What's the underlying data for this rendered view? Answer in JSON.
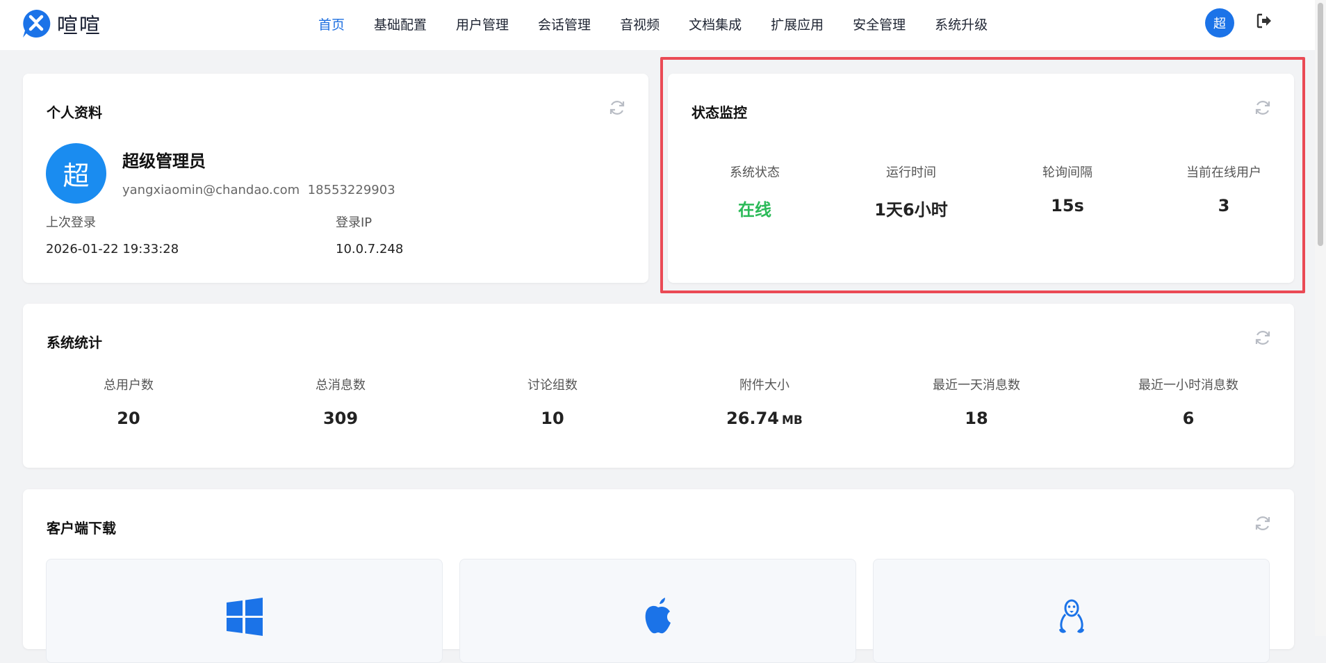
{
  "app": {
    "name": "喧喧"
  },
  "nav": {
    "items": [
      "首页",
      "基础配置",
      "用户管理",
      "会话管理",
      "音视频",
      "文档集成",
      "扩展应用",
      "安全管理",
      "系统升级"
    ],
    "active_index": 0
  },
  "header": {
    "avatar_char": "超"
  },
  "profile": {
    "title": "个人资料",
    "avatar_char": "超",
    "name": "超级管理员",
    "email": "yangxiaomin@chandao.com",
    "phone": "18553229903",
    "last_login_label": "上次登录",
    "last_login_value": "2026-01-22 19:33:28",
    "login_ip_label": "登录IP",
    "login_ip_value": "10.0.7.248"
  },
  "status": {
    "title": "状态监控",
    "metrics": [
      {
        "label": "系统状态",
        "value": "在线"
      },
      {
        "label": "运行时间",
        "value": "1天6小时"
      },
      {
        "label": "轮询间隔",
        "value": "15s"
      },
      {
        "label": "当前在线用户",
        "value": "3"
      }
    ]
  },
  "stats": {
    "title": "系统统计",
    "metrics": [
      {
        "label": "总用户数",
        "value": "20"
      },
      {
        "label": "总消息数",
        "value": "309"
      },
      {
        "label": "讨论组数",
        "value": "10"
      },
      {
        "label": "附件大小",
        "value": "26.74",
        "unit": "MB"
      },
      {
        "label": "最近一天消息数",
        "value": "18"
      },
      {
        "label": "最近一小时消息数",
        "value": "6"
      }
    ]
  },
  "download": {
    "title": "客户端下载",
    "tiles": [
      {
        "icon": "windows-icon"
      },
      {
        "icon": "apple-icon"
      },
      {
        "icon": "linux-icon"
      }
    ]
  },
  "colors": {
    "accent": "#1e6fe0",
    "online": "#2bba58",
    "highlight": "#ea4a55",
    "avatar": "#1a8cf0"
  }
}
